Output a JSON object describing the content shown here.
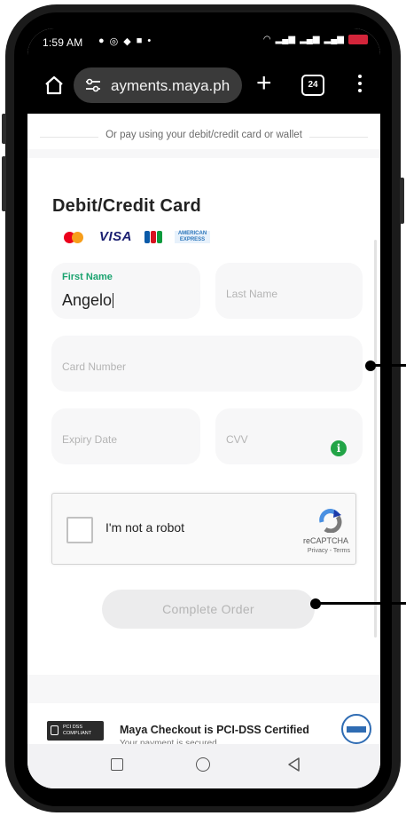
{
  "status_bar": {
    "time": "1:59 AM",
    "notification_icons": [
      "chat-icon",
      "messenger-icon",
      "location-icon",
      "facebook-icon",
      "dot-icon"
    ],
    "system_icons": [
      "wifi-icon",
      "signal-icon",
      "battery-icon"
    ],
    "battery_color": "#d3253a"
  },
  "browser": {
    "url": "ayments.maya.ph",
    "tab_count": "24"
  },
  "page": {
    "divider_text": "Or pay using your debit/credit card or wallet",
    "card_section_title": "Debit/Credit Card",
    "card_brands": [
      "mastercard-icon",
      "visa-icon",
      "jcb-icon",
      "amex-icon"
    ],
    "visa_text": "VISA",
    "amex_text": "AMERICAN EXPRESS",
    "fields": {
      "first_name": {
        "label": "First Name",
        "value": "Angelo"
      },
      "last_name": {
        "label": "Last Name",
        "value": ""
      },
      "card_number": {
        "label": "Card Number",
        "value": ""
      },
      "expiry_date": {
        "label": "Expiry Date",
        "value": ""
      },
      "cvv": {
        "label": "CVV",
        "value": ""
      }
    },
    "info_symbol": "i",
    "captcha": {
      "text": "I'm not a robot",
      "brand": "reCAPTCHA",
      "links": "Privacy - Terms"
    },
    "complete_button": "Complete Order",
    "footer": {
      "badge_text": "PCI DSS COMPLIANT",
      "title": "Maya Checkout is PCI-DSS Certified",
      "subtitle": "Your payment is secured"
    }
  },
  "colors": {
    "accent_green": "#1aa36f",
    "info_green": "#22a447",
    "field_bg": "#f7f7f8"
  }
}
